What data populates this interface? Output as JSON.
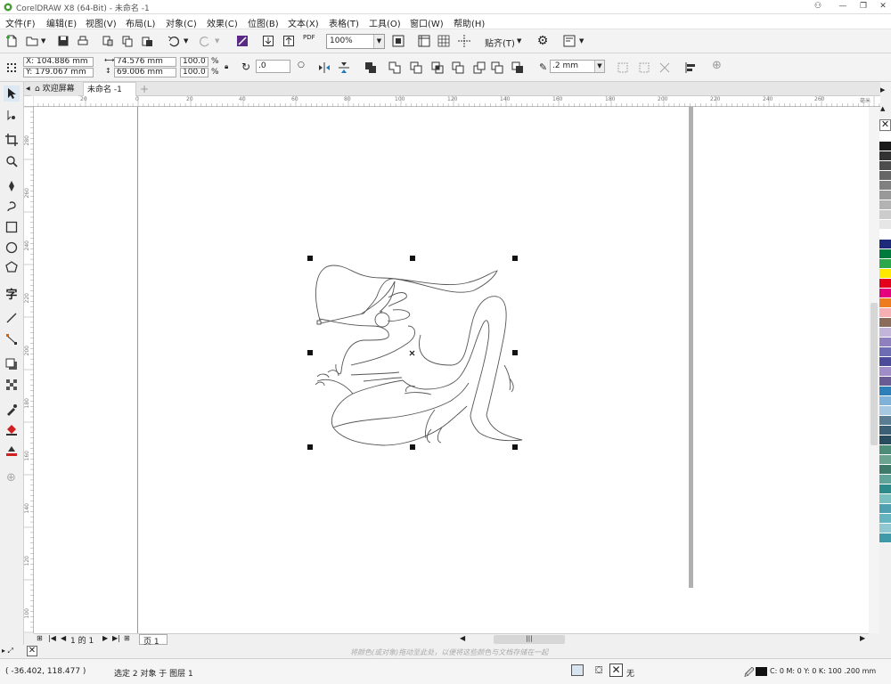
{
  "window": {
    "title": "CorelDRAW X8 (64-Bit) - 未命名 -1"
  },
  "menu": [
    "文件(F)",
    "编辑(E)",
    "视图(V)",
    "布局(L)",
    "对象(C)",
    "效果(C)",
    "位图(B)",
    "文本(X)",
    "表格(T)",
    "工具(O)",
    "窗口(W)",
    "帮助(H)"
  ],
  "toolbar": {
    "zoom": "100%",
    "snap_label": "贴齐(T)",
    "pdf_label": "PDF"
  },
  "property_bar": {
    "x": "X: 104.886 mm",
    "y": "Y: 179.067 mm",
    "width": "74.576 mm",
    "height": "69.006 mm",
    "scale_x": "100.0",
    "scale_y": "100.0",
    "pct": "%",
    "rotation": ".0",
    "outline": ".2 mm"
  },
  "tabs": {
    "welcome": "欢迎屏幕",
    "document": "未命名 -1"
  },
  "rulers": {
    "h": [
      "20",
      "0",
      "20",
      "40",
      "60",
      "80",
      "100",
      "120",
      "140",
      "160",
      "180",
      "200",
      "220",
      "240",
      "260",
      "毫米"
    ],
    "v": [
      "280",
      "260",
      "240",
      "220",
      "200",
      "180",
      "160",
      "140",
      "120",
      "100",
      "80"
    ]
  },
  "pagebar": {
    "page_count": "1 的 1",
    "page_tab": "页 1"
  },
  "color_hint": "将颜色(或对象)拖动至此处，以便将这些颜色与文档存储在一起",
  "status": {
    "coords": "( -36.402, 118.477 )",
    "selection": "选定 2 对象 于 图层 1",
    "fill": "无",
    "outline": "C: 0 M: 0 Y: 0 K: 100  .200 mm"
  },
  "palette": [
    "#ffffff",
    "#1a1a1a",
    "#333333",
    "#4d4d4d",
    "#666666",
    "#808080",
    "#999999",
    "#b3b3b3",
    "#cccccc",
    "#e6e6e6",
    "#ffffff",
    "#1e2a7a",
    "#007a3d",
    "#2da84a",
    "#ffe800",
    "#e2001a",
    "#e5007d",
    "#ee7c1e",
    "#f6b0b4",
    "#8b6b5a",
    "#c3b5d9",
    "#8e7fbf",
    "#6d6db3",
    "#4b4b9a",
    "#a08cc6",
    "#6b5b95",
    "#2c7fb8",
    "#7fb2d9",
    "#a6c8e0",
    "#5a7d94",
    "#3b5f75",
    "#294b5e",
    "#4e8c7a",
    "#6aa38f",
    "#3d7a6a",
    "#5fa39a",
    "#2e8b8b",
    "#7abfbf",
    "#4fa0b0",
    "#65b5c0",
    "#8fc8d0",
    "#3e9aa8"
  ],
  "accent": "#e4141b"
}
